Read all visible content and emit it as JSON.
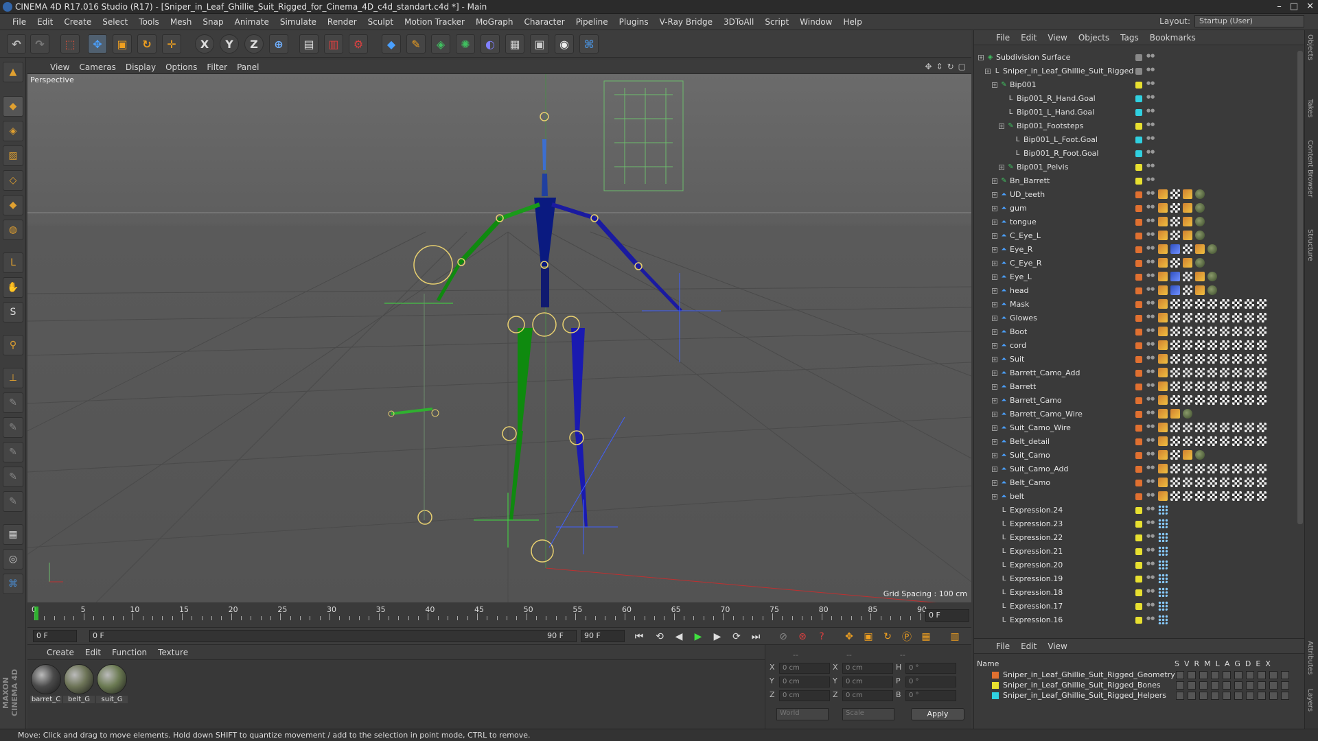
{
  "window": {
    "title": "CINEMA 4D R17.016 Studio (R17) - [Sniper_in_Leaf_Ghillie_Suit_Rigged_for_Cinema_4D_c4d_standart.c4d *] - Main",
    "controls": [
      "–",
      "□",
      "✕"
    ]
  },
  "menubar": {
    "items": [
      "File",
      "Edit",
      "Create",
      "Select",
      "Tools",
      "Mesh",
      "Snap",
      "Animate",
      "Simulate",
      "Render",
      "Sculpt",
      "Motion Tracker",
      "MoGraph",
      "Character",
      "Pipeline",
      "Plugins",
      "V-Ray Bridge",
      "3DToAll",
      "Script",
      "Window",
      "Help"
    ],
    "layout_label": "Layout:",
    "layout_value": "Startup (User)"
  },
  "toolbar": {
    "icons": [
      "undo-icon",
      "redo-icon",
      "live-selection-icon",
      "move-icon",
      "scale-icon",
      "rotate-icon",
      "recent-tool-icon",
      "x-axis-icon",
      "y-axis-icon",
      "z-axis-icon",
      "world-coord-icon",
      "render-view-icon",
      "render-picture-queue-icon",
      "render-settings-icon",
      "cube-icon",
      "pen-icon",
      "subdivision-icon",
      "array-icon",
      "deformer-icon",
      "floor-icon",
      "camera-icon",
      "light-icon",
      "python-icon"
    ],
    "axis_labels": [
      "X",
      "Y",
      "Z"
    ]
  },
  "lefttools": {
    "icons": [
      "model-mode-icon",
      "texture-mode-icon",
      "workplane-icon",
      "points-mode-icon",
      "edges-mode-icon",
      "polygons-mode-icon",
      "uv-mode-icon",
      "tweak-icon",
      "snap-icon",
      "magnet-icon",
      "axis-mode-icon",
      "brush-icon",
      "sculpt-icon",
      "knife-icon",
      "bevel-icon",
      "paint-icon",
      "weight-icon",
      "lock-icon",
      "python-icon"
    ],
    "brand": "MAXON CINEMA 4D"
  },
  "viewport": {
    "menu": [
      "View",
      "Cameras",
      "Display",
      "Options",
      "Filter",
      "Panel"
    ],
    "label": "Perspective",
    "grid_spacing": "Grid Spacing : 100 cm"
  },
  "timeline": {
    "ticks": [
      "0",
      "5",
      "10",
      "15",
      "20",
      "25",
      "30",
      "35",
      "40",
      "45",
      "50",
      "55",
      "60",
      "65",
      "70",
      "75",
      "80",
      "85",
      "90"
    ],
    "current_frame": "0 F",
    "start_field": "0 F",
    "range_start": "0 F",
    "range_end": "90 F",
    "end_field": "90 F"
  },
  "material_manager": {
    "menu": [
      "Create",
      "Edit",
      "Function",
      "Texture"
    ],
    "materials": [
      {
        "name": "barret_C",
        "color": "#4a4a4a"
      },
      {
        "name": "belt_G",
        "color": "#6c7356"
      },
      {
        "name": "suit_G",
        "color": "#6b7a52"
      }
    ]
  },
  "coordinates": {
    "headers": [
      "--",
      "--",
      "--"
    ],
    "rows": [
      {
        "a": "X",
        "av": "0 cm",
        "b": "X",
        "bv": "0 cm",
        "c": "H",
        "cv": "0 °"
      },
      {
        "a": "Y",
        "av": "0 cm",
        "b": "Y",
        "bv": "0 cm",
        "c": "P",
        "cv": "0 °"
      },
      {
        "a": "Z",
        "av": "0 cm",
        "b": "Z",
        "bv": "0 cm",
        "c": "B",
        "cv": "0 °"
      }
    ],
    "mode_world": "World",
    "mode_scale": "Scale",
    "apply": "Apply"
  },
  "object_manager": {
    "menu": [
      "File",
      "Edit",
      "View",
      "Objects",
      "Tags",
      "Bookmarks"
    ],
    "rows": [
      {
        "name": "Subdivision Surface",
        "depth": 0,
        "icon": "subdivision",
        "layer": "#888",
        "tags": "none"
      },
      {
        "name": "Sniper_in_Leaf_Ghillie_Suit_Rigged",
        "depth": 1,
        "icon": "null",
        "layer": "#888",
        "tags": "none"
      },
      {
        "name": "Bip001",
        "depth": 2,
        "icon": "bone",
        "layer": "#e8e030",
        "tags": "none"
      },
      {
        "name": "Bip001_R_Hand.Goal",
        "depth": 3,
        "icon": "null",
        "layer": "#30d0e0",
        "tags": "none"
      },
      {
        "name": "Bip001_L_Hand.Goal",
        "depth": 3,
        "icon": "null",
        "layer": "#30d0e0",
        "tags": "none"
      },
      {
        "name": "Bip001_Footsteps",
        "depth": 3,
        "icon": "bone",
        "layer": "#e8e030",
        "tags": "none"
      },
      {
        "name": "Bip001_L_Foot.Goal",
        "depth": 4,
        "icon": "null",
        "layer": "#30d0e0",
        "tags": "none"
      },
      {
        "name": "Bip001_R_Foot.Goal",
        "depth": 4,
        "icon": "null",
        "layer": "#30d0e0",
        "tags": "none"
      },
      {
        "name": "Bip001_Pelvis",
        "depth": 3,
        "icon": "bone",
        "layer": "#e8e030",
        "tags": "none"
      },
      {
        "name": "Bn_Barrett",
        "depth": 2,
        "icon": "bone",
        "layer": "#e8e030",
        "tags": "none"
      },
      {
        "name": "UD_teeth",
        "depth": 2,
        "icon": "poly",
        "layer": "#e07030",
        "tags": "short"
      },
      {
        "name": "gum",
        "depth": 2,
        "icon": "poly",
        "layer": "#e07030",
        "tags": "short"
      },
      {
        "name": "tongue",
        "depth": 2,
        "icon": "poly",
        "layer": "#e07030",
        "tags": "short"
      },
      {
        "name": "C_Eye_L",
        "depth": 2,
        "icon": "poly",
        "layer": "#e07030",
        "tags": "short"
      },
      {
        "name": "Eye_R",
        "depth": 2,
        "icon": "poly",
        "layer": "#e07030",
        "tags": "ik"
      },
      {
        "name": "C_Eye_R",
        "depth": 2,
        "icon": "poly",
        "layer": "#e07030",
        "tags": "short"
      },
      {
        "name": "Eye_L",
        "depth": 2,
        "icon": "poly",
        "layer": "#e07030",
        "tags": "ik"
      },
      {
        "name": "head",
        "depth": 2,
        "icon": "poly",
        "layer": "#e07030",
        "tags": "ik"
      },
      {
        "name": "Mask",
        "depth": 2,
        "icon": "poly",
        "layer": "#e07030",
        "tags": "long"
      },
      {
        "name": "Glowes",
        "depth": 2,
        "icon": "poly",
        "layer": "#e07030",
        "tags": "long"
      },
      {
        "name": "Boot",
        "depth": 2,
        "icon": "poly",
        "layer": "#e07030",
        "tags": "long"
      },
      {
        "name": "cord",
        "depth": 2,
        "icon": "poly",
        "layer": "#e07030",
        "tags": "long"
      },
      {
        "name": "Suit",
        "depth": 2,
        "icon": "poly",
        "layer": "#e07030",
        "tags": "long"
      },
      {
        "name": "Barrett_Camo_Add",
        "depth": 2,
        "icon": "poly",
        "layer": "#e07030",
        "tags": "long"
      },
      {
        "name": "Barrett",
        "depth": 2,
        "icon": "poly",
        "layer": "#e07030",
        "tags": "long"
      },
      {
        "name": "Barrett_Camo",
        "depth": 2,
        "icon": "poly",
        "layer": "#e07030",
        "tags": "long"
      },
      {
        "name": "Barrett_Camo_Wire",
        "depth": 2,
        "icon": "poly",
        "layer": "#e07030",
        "tags": "wire"
      },
      {
        "name": "Suit_Camo_Wire",
        "depth": 2,
        "icon": "poly",
        "layer": "#e07030",
        "tags": "long"
      },
      {
        "name": "Belt_detail",
        "depth": 2,
        "icon": "poly",
        "layer": "#e07030",
        "tags": "long"
      },
      {
        "name": "Suit_Camo",
        "depth": 2,
        "icon": "poly",
        "layer": "#e07030",
        "tags": "short"
      },
      {
        "name": "Suit_Camo_Add",
        "depth": 2,
        "icon": "poly",
        "layer": "#e07030",
        "tags": "long"
      },
      {
        "name": "Belt_Camo",
        "depth": 2,
        "icon": "poly",
        "layer": "#e07030",
        "tags": "long"
      },
      {
        "name": "belt",
        "depth": 2,
        "icon": "poly",
        "layer": "#e07030",
        "tags": "long"
      },
      {
        "name": "Expression.24",
        "depth": 2,
        "icon": "null",
        "layer": "#e8e030",
        "tags": "expr"
      },
      {
        "name": "Expression.23",
        "depth": 2,
        "icon": "null",
        "layer": "#e8e030",
        "tags": "expr"
      },
      {
        "name": "Expression.22",
        "depth": 2,
        "icon": "null",
        "layer": "#e8e030",
        "tags": "expr"
      },
      {
        "name": "Expression.21",
        "depth": 2,
        "icon": "null",
        "layer": "#e8e030",
        "tags": "expr"
      },
      {
        "name": "Expression.20",
        "depth": 2,
        "icon": "null",
        "layer": "#e8e030",
        "tags": "expr"
      },
      {
        "name": "Expression.19",
        "depth": 2,
        "icon": "null",
        "layer": "#e8e030",
        "tags": "expr"
      },
      {
        "name": "Expression.18",
        "depth": 2,
        "icon": "null",
        "layer": "#e8e030",
        "tags": "expr"
      },
      {
        "name": "Expression.17",
        "depth": 2,
        "icon": "null",
        "layer": "#e8e030",
        "tags": "expr"
      },
      {
        "name": "Expression.16",
        "depth": 2,
        "icon": "null",
        "layer": "#e8e030",
        "tags": "expr"
      }
    ]
  },
  "layer_manager": {
    "menu": [
      "File",
      "Edit",
      "View"
    ],
    "name_header": "Name",
    "columns": [
      "S",
      "V",
      "R",
      "M",
      "L",
      "A",
      "G",
      "D",
      "E",
      "X"
    ],
    "layers": [
      {
        "name": "Sniper_in_Leaf_Ghillie_Suit_Rigged_Geometry",
        "color": "#e07030"
      },
      {
        "name": "Sniper_in_Leaf_Ghillie_Suit_Rigged_Bones",
        "color": "#e8e030"
      },
      {
        "name": "Sniper_in_Leaf_Ghillie_Suit_Rigged_Helpers",
        "color": "#30d0e0"
      }
    ]
  },
  "side_tabs": [
    "Objects",
    "Takes",
    "Content Browser",
    "Structure",
    "Attributes",
    "Layers"
  ],
  "status": "Move: Click and drag to move elements. Hold down SHIFT to quantize movement / add to the selection in point mode, CTRL to remove."
}
